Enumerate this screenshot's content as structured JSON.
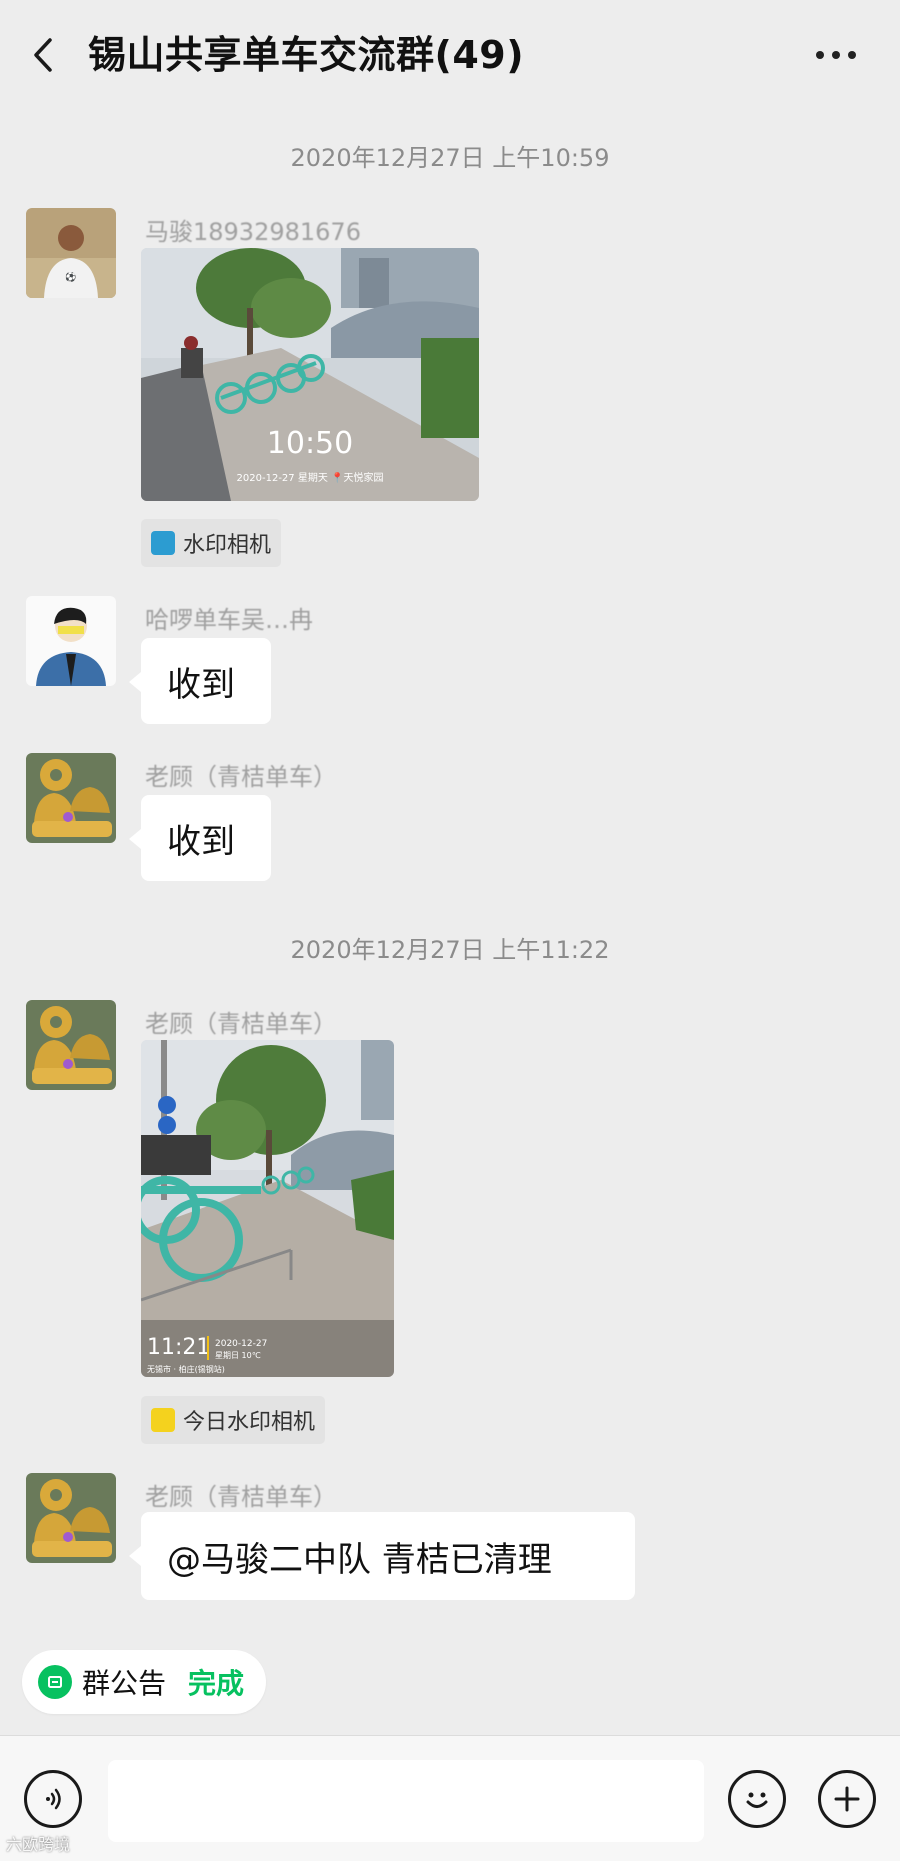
{
  "header": {
    "title": "锡山共享单车交流群(49)"
  },
  "timestamps": [
    "2020年12月27日 上午10:59",
    "2020年12月27日 上午11:22"
  ],
  "messages": [
    {
      "sender": "马骏18932981676",
      "photo_time": "10:50",
      "photo_caption": "2020-12-27 星期天 📍天悦家园",
      "app_tag": "水印相机"
    },
    {
      "sender": "哈啰单车吴…冉",
      "text": "收到"
    },
    {
      "sender": "老顾（青桔单车）",
      "text": "收到"
    },
    {
      "sender": "老顾（青桔单车）",
      "photo_time": "11:21",
      "photo_date": "2020-12-27",
      "photo_weekday": "星期日 10℃",
      "photo_location": "无锡市 · 柏庄(锡钢站)",
      "app_tag": "今日水印相机"
    },
    {
      "sender": "老顾（青桔单车）",
      "text": "@马骏二中队  青桔已清理"
    }
  ],
  "notice": {
    "label": "群公告",
    "done": "完成"
  },
  "watermark": "六欧跨境",
  "colors": {
    "background": "#ededed",
    "accent": "#07c160",
    "bubble": "#ffffff"
  }
}
